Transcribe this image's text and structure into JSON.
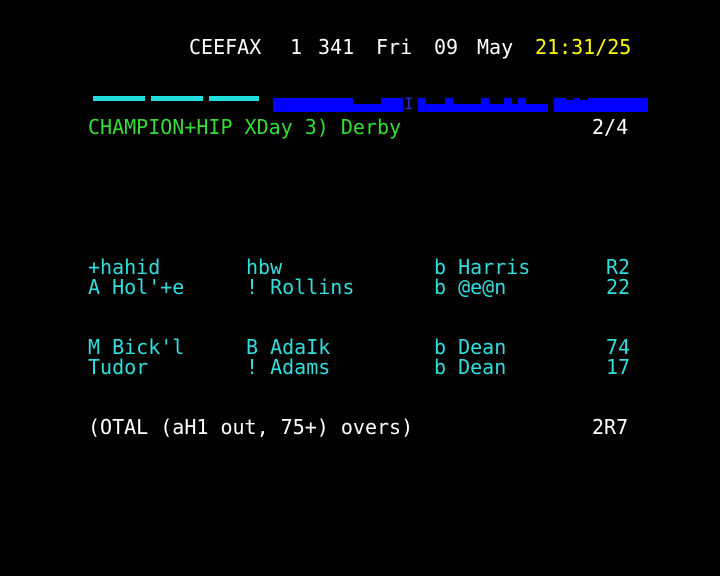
{
  "header": {
    "service": "CEEFAX",
    "page_sub": "1",
    "page_number": "341",
    "day": "Fri",
    "date": "09",
    "month": "May",
    "time": "21:31/25"
  },
  "title_bar": {
    "title": "CHAMPION+HIP XDay 3) Derby",
    "page_count": "2/4",
    "band_glyph": "I"
  },
  "batting": [
    {
      "batsman": "+hahid",
      "how_out": "hbw",
      "bowler": "b Harris",
      "runs": "R2"
    },
    {
      "batsman": "A Hol'+e",
      "how_out": "! Rollins",
      "bowler": "b @e@n",
      "runs": "22"
    },
    {
      "batsman": "M Bick'l",
      "how_out": "B AdaIk",
      "bowler": "b Dean",
      "runs": "74"
    },
    {
      "batsman": "Tudor",
      "how_out": "! Adams",
      "bowler": "b Dean",
      "runs": "17"
    }
  ],
  "total": {
    "label": "(OTAL (aH1 out, 75+) overs)",
    "value": "2R7"
  },
  "colors": {
    "background": "#000000",
    "header_text": "#ffffff",
    "clock": "#ffff00",
    "title": "#33dd33",
    "body_text": "#33dddd",
    "band_blue": "#0000ff",
    "band_cyan": "#22dddd"
  }
}
